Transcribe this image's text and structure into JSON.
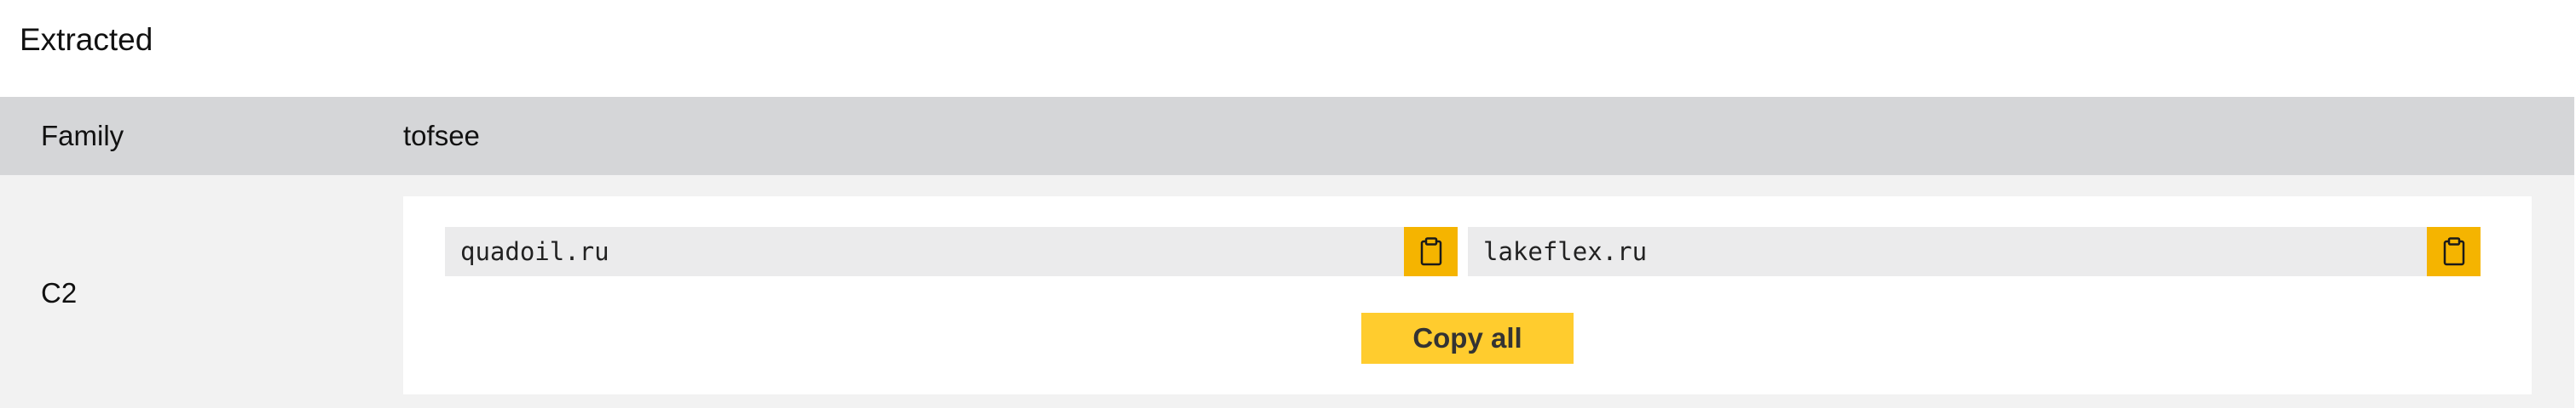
{
  "section": {
    "title": "Extracted"
  },
  "family": {
    "label": "Family",
    "value": "tofsee"
  },
  "c2": {
    "label": "C2",
    "entries": [
      {
        "value": "quadoil.ru",
        "copy_icon": "clipboard-icon"
      },
      {
        "value": "lakeflex.ru",
        "copy_icon": "clipboard-icon"
      }
    ],
    "copy_all_label": "Copy all"
  },
  "colors": {
    "row_family_bg": "#d5d6d8",
    "row_c2_bg": "#f2f2f2",
    "field_bg": "#ebebec",
    "copy_button": "#f5b400",
    "copy_all_button": "#ffcc2e"
  }
}
